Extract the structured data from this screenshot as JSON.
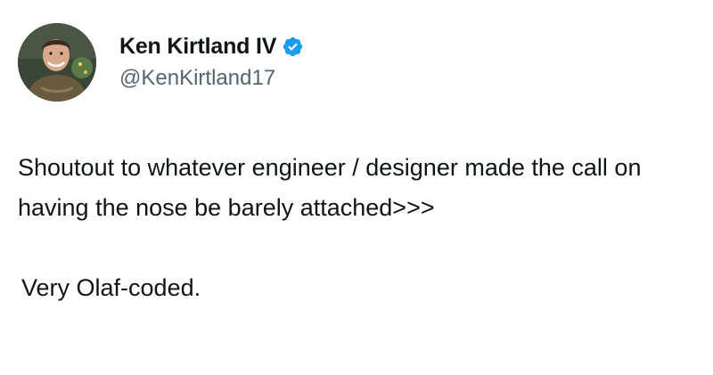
{
  "author": {
    "display_name": "Ken Kirtland IV",
    "handle": "@KenKirtland17",
    "avatar_icon": "profile-photo",
    "verified_icon": "verified-badge-icon",
    "verified_color": "#1d9bf0"
  },
  "tweet": {
    "paragraphs": [
      "Shoutout to whatever engineer / designer made the call on having the nose be barely attached>>>",
      "Very Olaf-coded."
    ]
  }
}
